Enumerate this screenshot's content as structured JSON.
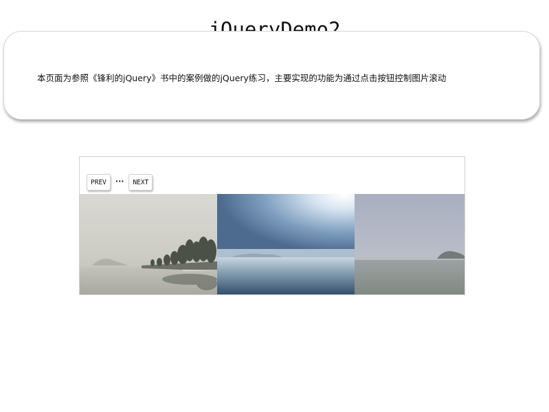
{
  "page": {
    "title": "jQueryDemo2"
  },
  "intro": {
    "text": "本页面为参照《锋利的jQuery》书中的案例做的jQuery练习，主要实现的功能为通过点击按钮控制图片滚动"
  },
  "slider": {
    "prev_label": "PREV",
    "ellipsis": "···",
    "next_label": "NEXT",
    "photos": [
      {
        "name": "misty-lake-trees-photo"
      },
      {
        "name": "blue-sky-lake-photo"
      },
      {
        "name": "hazy-lake-island-photo"
      }
    ]
  }
}
